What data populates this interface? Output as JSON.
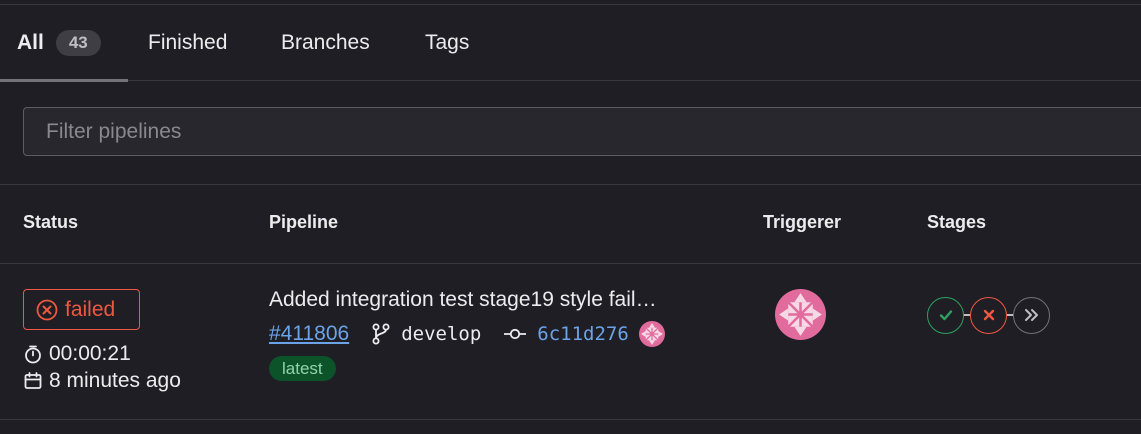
{
  "tabs": [
    {
      "label": "All",
      "count": "43"
    },
    {
      "label": "Finished"
    },
    {
      "label": "Branches"
    },
    {
      "label": "Tags"
    }
  ],
  "filter": {
    "placeholder": "Filter pipelines"
  },
  "table": {
    "headers": [
      "Status",
      "Pipeline",
      "Triggerer",
      "Stages"
    ],
    "rows": [
      {
        "status": "failed",
        "duration": "00:00:21",
        "finished_ago": "8 minutes ago",
        "commit_title": "Added integration test stage19 style fail…",
        "pipeline_id": "#411806",
        "branch": "develop",
        "commit_sha": "6c11d276",
        "badge": "latest",
        "triggerer_avatar": "identicon-pink",
        "stages": [
          {
            "status": "success",
            "icon": "check-icon"
          },
          {
            "status": "failed",
            "icon": "close-icon"
          },
          {
            "status": "more",
            "icon": "chevron-double-right-icon"
          }
        ]
      }
    ]
  },
  "colors": {
    "failed": "#ec5941",
    "success": "#2da160",
    "link": "#6aa3e8",
    "latest_bg": "#0d532a",
    "avatar": "#e06b9c"
  }
}
